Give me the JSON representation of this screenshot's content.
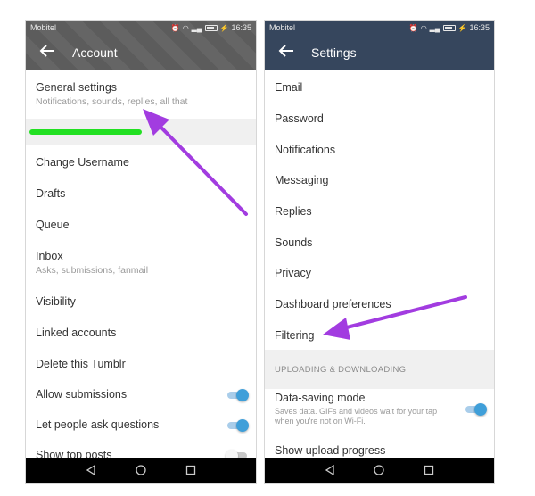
{
  "colors": {
    "accent_toggle": "#3f9fd9",
    "appbar_right": "#36465d",
    "arrow": "#a23ce0",
    "highlight_line": "#22e022"
  },
  "left_screen": {
    "status": {
      "carrier": "Mobitel",
      "time": "16:35"
    },
    "title": "Account",
    "general_settings": {
      "label": "General settings",
      "subtitle": "Notifications, sounds, replies, all that"
    },
    "items": [
      {
        "label": "Change Username"
      },
      {
        "label": "Drafts"
      },
      {
        "label": "Queue"
      },
      {
        "label": "Inbox",
        "subtitle": "Asks, submissions, fanmail"
      },
      {
        "label": "Visibility"
      },
      {
        "label": "Linked accounts"
      },
      {
        "label": "Delete this Tumblr"
      }
    ],
    "toggles": [
      {
        "label": "Allow submissions",
        "on": true
      },
      {
        "label": "Let people ask questions",
        "on": true
      },
      {
        "label": "Show top posts",
        "on": false
      }
    ]
  },
  "right_screen": {
    "status": {
      "carrier": "Mobitel",
      "time": "16:35"
    },
    "title": "Settings",
    "items": [
      {
        "label": "Email"
      },
      {
        "label": "Password"
      },
      {
        "label": "Notifications"
      },
      {
        "label": "Messaging"
      },
      {
        "label": "Replies"
      },
      {
        "label": "Sounds"
      },
      {
        "label": "Privacy"
      },
      {
        "label": "Dashboard preferences"
      },
      {
        "label": "Filtering"
      }
    ],
    "section_header": "UPLOADING & DOWNLOADING",
    "data_saving": {
      "label": "Data-saving mode",
      "subtitle": "Saves data. GIFs and videos wait for your tap when you're not on Wi-Fi.",
      "on": true
    },
    "upload_progress": {
      "label": "Show upload progress"
    }
  },
  "icons": {
    "back": "arrow-left",
    "nav_back": "triangle-left",
    "nav_home": "circle",
    "nav_recents": "square"
  }
}
